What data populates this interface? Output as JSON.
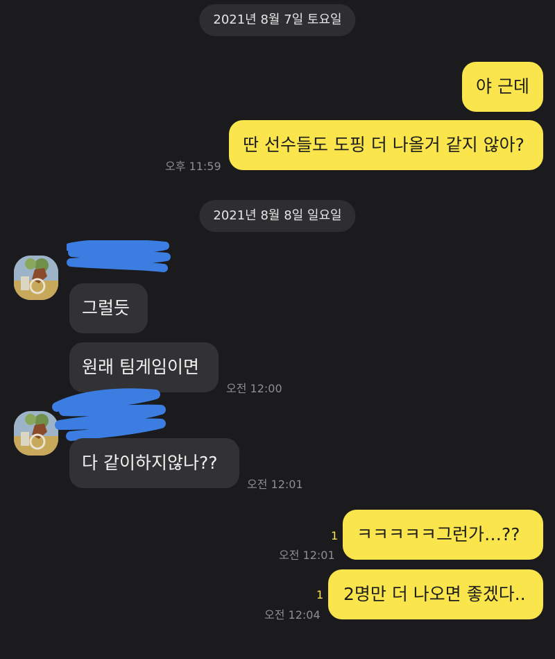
{
  "dates": {
    "first": "2021년 8월 7일 토요일",
    "second": "2021년 8월 8일 일요일"
  },
  "messages": {
    "m1": {
      "text": "야 근데"
    },
    "m2": {
      "text": "딴 선수들도 도핑 더 나올거 같지 않아?",
      "time": "오후 11:59"
    },
    "m3": {
      "text": "그럴듯"
    },
    "m4": {
      "text": "원래 팀게임이면",
      "time": "오전 12:00"
    },
    "m5": {
      "text": "다 같이하지않나??",
      "time": "오전 12:01"
    },
    "m6": {
      "text": "ㅋㅋㅋㅋㅋ그런가…??",
      "time": "오전 12:01",
      "unread": "1"
    },
    "m7": {
      "text": "2명만 더 나오면 좋겠다..",
      "time": "오전 12:04",
      "unread": "1"
    }
  },
  "colors": {
    "background": "#1b1b1d",
    "my_bubble": "#fae54d",
    "their_bubble": "#323235",
    "redaction": "#3b7de0"
  },
  "icons": {
    "avatar": "profile-picture-illustration"
  }
}
